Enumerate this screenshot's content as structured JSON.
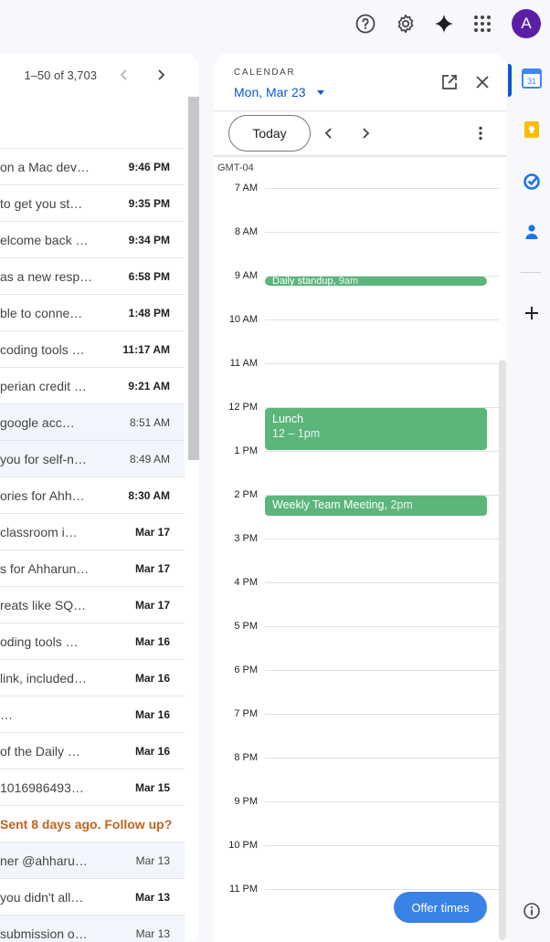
{
  "header": {
    "help_icon": "help-icon",
    "settings_icon": "gear-icon",
    "gemini_icon": "sparkle-icon",
    "apps_icon": "apps-grid-icon",
    "avatar_letter": "A",
    "avatar_color": "#5b1fa6"
  },
  "mail": {
    "range_label": "1–50 of 3,703",
    "rows": [
      {
        "snippet": "on a Mac dev…",
        "date": "9:46 PM",
        "state": "unread"
      },
      {
        "snippet": "to get you st…",
        "date": "9:35 PM",
        "state": "unread"
      },
      {
        "snippet": "elcome back …",
        "date": "9:34 PM",
        "state": "unread"
      },
      {
        "snippet": "as a new resp…",
        "date": "6:58 PM",
        "state": "unread"
      },
      {
        "snippet": "ble to conne…",
        "date": "1:48 PM",
        "state": "unread"
      },
      {
        "snippet": "coding tools …",
        "date": "11:17 AM",
        "state": "unread"
      },
      {
        "snippet": "perian credit …",
        "date": "9:21 AM",
        "state": "unread"
      },
      {
        "snippet": "google acc…",
        "date": "8:51 AM",
        "state": "read"
      },
      {
        "snippet": "you for self-n…",
        "date": "8:49 AM",
        "state": "read"
      },
      {
        "snippet": "ories for Ahh…",
        "date": "8:30 AM",
        "state": "unread"
      },
      {
        "snippet": "classroom i…",
        "date": "Mar 17",
        "state": "unread"
      },
      {
        "snippet": "s for Ahharun…",
        "date": "Mar 17",
        "state": "unread"
      },
      {
        "snippet": "reats like SQ…",
        "date": "Mar 17",
        "state": "unread"
      },
      {
        "snippet": "oding tools   …",
        "date": "Mar 16",
        "state": "unread"
      },
      {
        "snippet": "link, included…",
        "date": "Mar 16",
        "state": "unread"
      },
      {
        "snippet": "…",
        "date": "Mar 16",
        "state": "unread"
      },
      {
        "snippet": "of the Daily …",
        "date": "Mar 16",
        "state": "unread"
      },
      {
        "snippet": "1016986493…",
        "date": "Mar 15",
        "state": "unread"
      },
      {
        "snippet": "Sent 8 days ago. Follow up?",
        "date": "",
        "state": "followup"
      },
      {
        "snippet": "ner @ahharu…",
        "date": "Mar 13",
        "state": "read"
      },
      {
        "snippet": "you didn't all…",
        "date": "Mar 13",
        "state": "unread"
      },
      {
        "snippet": "submission o…",
        "date": "Mar 13",
        "state": "read"
      }
    ]
  },
  "calendar": {
    "label": "CALENDAR",
    "date_label": "Mon, Mar 23",
    "today_label": "Today",
    "timezone": "GMT-04",
    "hours": [
      "7 AM",
      "8 AM",
      "9 AM",
      "10 AM",
      "11 AM",
      "12 PM",
      "1 PM",
      "2 PM",
      "3 PM",
      "4 PM",
      "5 PM",
      "6 PM",
      "7 PM",
      "8 PM",
      "9 PM",
      "10 PM",
      "11 PM"
    ],
    "events": [
      {
        "title": "Daily standup",
        "time": "9am",
        "start_hour": 9.0,
        "end_hour": 9.25,
        "layout": "inline"
      },
      {
        "title": "Lunch",
        "time": "12 – 1pm",
        "start_hour": 12.0,
        "end_hour": 13.0,
        "layout": "stacked"
      },
      {
        "title": "Weekly Team Meeting",
        "time": "2pm",
        "start_hour": 14.0,
        "end_hour": 14.5,
        "layout": "inline"
      }
    ],
    "event_color": "#5cb57b",
    "offer_times_label": "Offer times"
  },
  "rail": {
    "calendar_day": "31",
    "items": [
      "calendar-icon",
      "keep-icon",
      "tasks-icon",
      "contacts-icon",
      "add-icon",
      "info-icon"
    ]
  }
}
